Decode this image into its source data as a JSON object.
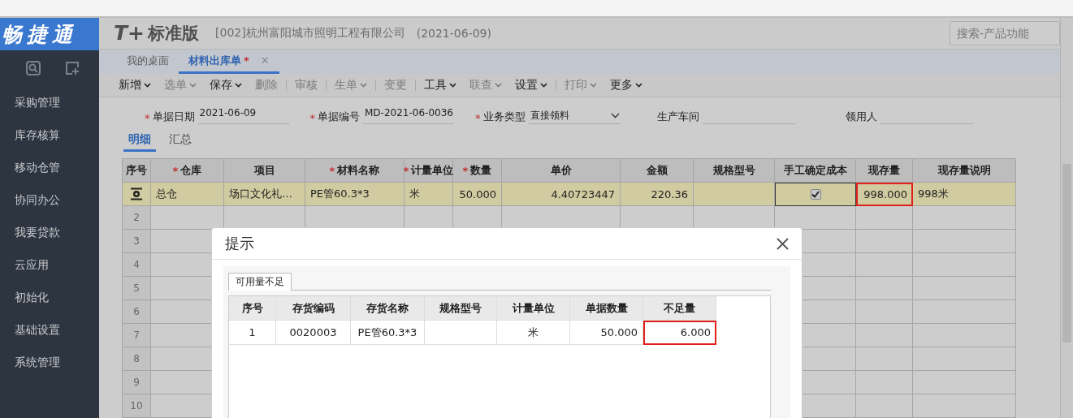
{
  "brand": {
    "logo": "畅捷通",
    "product_mark": "T+",
    "product_name": "标准版",
    "company": "[002]杭州富阳城市照明工程有限公司",
    "date": "(2021-06-09)"
  },
  "search": {
    "placeholder": "搜索-产品功能"
  },
  "sidebar": {
    "items": [
      "采购管理",
      "库存核算",
      "移动仓管",
      "协同办公",
      "我要贷款",
      "云应用",
      "初始化",
      "基础设置",
      "系统管理"
    ]
  },
  "tabs": [
    {
      "label": "我的桌面",
      "selected": false,
      "modified": false,
      "closable": false
    },
    {
      "label": "材料出库单",
      "selected": true,
      "modified": true,
      "closable": true
    }
  ],
  "modified_mark": "*",
  "close_glyph": "✕",
  "toolbar": [
    {
      "label": "新增",
      "dropdown": true,
      "disabled": false,
      "divider_after": false
    },
    {
      "label": "选单",
      "dropdown": true,
      "disabled": true,
      "divider_after": false
    },
    {
      "label": "保存",
      "dropdown": true,
      "disabled": false,
      "divider_after": false
    },
    {
      "label": "删除",
      "dropdown": false,
      "disabled": true,
      "divider_after": true
    },
    {
      "label": "审核",
      "dropdown": false,
      "disabled": true,
      "divider_after": true
    },
    {
      "label": "生单",
      "dropdown": true,
      "disabled": true,
      "divider_after": true
    },
    {
      "label": "变更",
      "dropdown": false,
      "disabled": true,
      "divider_after": true
    },
    {
      "label": "工具",
      "dropdown": true,
      "disabled": false,
      "divider_after": false
    },
    {
      "label": "联查",
      "dropdown": true,
      "disabled": true,
      "divider_after": false
    },
    {
      "label": "设置",
      "dropdown": true,
      "disabled": false,
      "divider_after": true
    },
    {
      "label": "打印",
      "dropdown": true,
      "disabled": true,
      "divider_after": false
    },
    {
      "label": "更多",
      "dropdown": true,
      "disabled": false,
      "divider_after": false
    }
  ],
  "required_mark": "*",
  "form": [
    {
      "label": "单据日期",
      "required": true,
      "kind": "text",
      "value": "2021-06-09"
    },
    {
      "label": "单据编号",
      "required": true,
      "kind": "text",
      "value": "MD-2021-06-0036"
    },
    {
      "label": "业务类型",
      "required": true,
      "kind": "select",
      "value": "直接领料"
    },
    {
      "label": "生产车间",
      "required": false,
      "kind": "text"
    },
    {
      "label": "领用人",
      "required": false,
      "kind": "text"
    }
  ],
  "sub_tabs": [
    {
      "label": "明细",
      "selected": true
    },
    {
      "label": "汇总",
      "selected": false
    }
  ],
  "grid": {
    "columns": [
      {
        "label": "序号",
        "required": false,
        "highlighted": false
      },
      {
        "label": "仓库",
        "required": true,
        "highlighted": false
      },
      {
        "label": "项目",
        "required": false,
        "highlighted": false
      },
      {
        "label": "材料名称",
        "required": true,
        "highlighted": false
      },
      {
        "label": "计量单位",
        "required": true,
        "highlighted": false
      },
      {
        "label": "数量",
        "required": true,
        "highlighted": false
      },
      {
        "label": "单价",
        "required": false,
        "highlighted": false
      },
      {
        "label": "金额",
        "required": false,
        "highlighted": false
      },
      {
        "label": "规格型号",
        "required": false,
        "highlighted": false
      },
      {
        "label": "手工确定成本",
        "required": false,
        "highlighted": false
      },
      {
        "label": "现存量",
        "required": false,
        "highlighted": true
      },
      {
        "label": "现存量说明",
        "required": false,
        "highlighted": false
      }
    ],
    "rows": [
      {
        "selected": true,
        "cells": [
          {
            "kind": "gear"
          },
          {
            "kind": "text",
            "text": "总仓"
          },
          {
            "kind": "text",
            "text": "场口文化礼…"
          },
          {
            "kind": "text",
            "text": "PE管60.3*3"
          },
          {
            "kind": "text",
            "text": "米"
          },
          {
            "kind": "number",
            "text": "50.000"
          },
          {
            "kind": "number",
            "text": "4.40723447"
          },
          {
            "kind": "number",
            "text": "220.36"
          },
          {
            "kind": "empty"
          },
          {
            "kind": "checkbox",
            "checked": true
          },
          {
            "kind": "number",
            "text": "998.000"
          },
          {
            "kind": "text",
            "text": "998米"
          }
        ]
      }
    ],
    "empty_row_numbers": [
      "2",
      "3",
      "4",
      "5",
      "6",
      "7",
      "8",
      "9",
      "10"
    ]
  },
  "dialog": {
    "title": "提示",
    "tab": "可用量不足",
    "columns": [
      {
        "label": "序号",
        "highlighted": false
      },
      {
        "label": "存货编码",
        "highlighted": false
      },
      {
        "label": "存货名称",
        "highlighted": false
      },
      {
        "label": "规格型号",
        "highlighted": false
      },
      {
        "label": "计量单位",
        "highlighted": false
      },
      {
        "label": "单据数量",
        "highlighted": false
      },
      {
        "label": "不足量",
        "highlighted": true
      }
    ],
    "rows": [
      [
        {
          "kind": "center",
          "text": "1"
        },
        {
          "kind": "center",
          "text": "0020003"
        },
        {
          "kind": "center",
          "text": "PE管60.3*3"
        },
        {
          "kind": "empty"
        },
        {
          "kind": "center",
          "text": "米"
        },
        {
          "kind": "number",
          "text": "50.000"
        },
        {
          "kind": "number",
          "text": "6.000"
        }
      ]
    ]
  }
}
